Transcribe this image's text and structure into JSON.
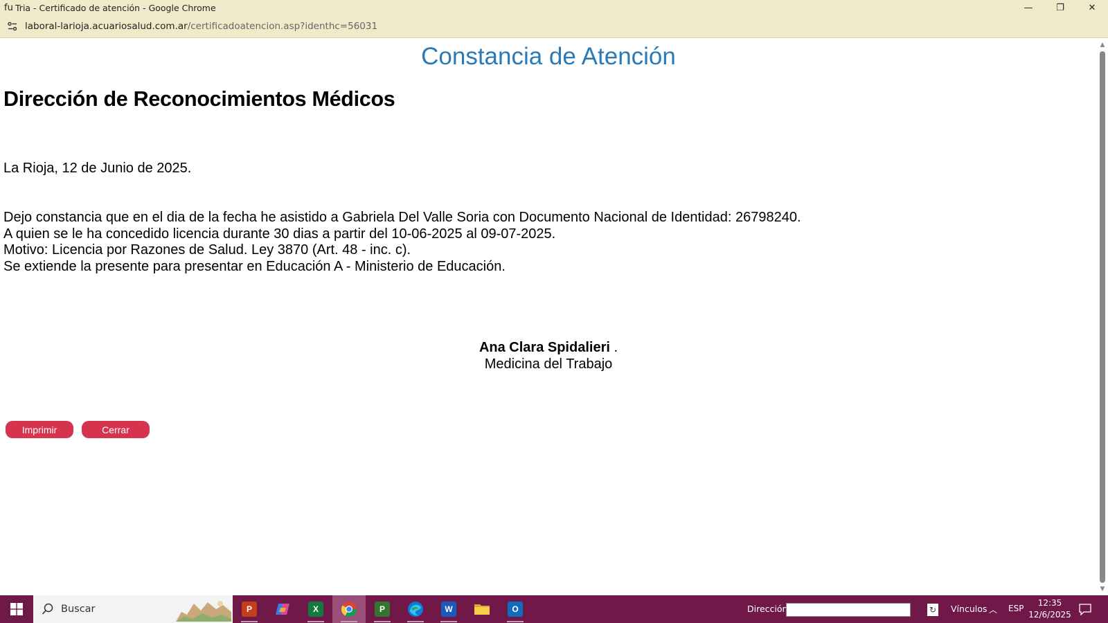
{
  "window": {
    "tab_icon": "fu",
    "title": "Tria - Certificado de atención - Google Chrome",
    "controls": {
      "minimize": "—",
      "restore": "❐",
      "close": "✕"
    }
  },
  "address": {
    "host": "laboral-larioja.acuariosalud.com.ar",
    "path": "/certificadoatencion.asp?identhc=56031"
  },
  "page": {
    "heading": "Constancia de Atención",
    "organization": "Dirección de Reconocimientos Médicos",
    "date_line": "La Rioja, 12 de Junio de 2025.",
    "body_lines": [
      "Dejo constancia que en el dia de la fecha he asistido a Gabriela Del Valle Soria con Documento Nacional de Identidad: 26798240.",
      "A quien se le ha concedido licencia durante 30 dias a partir del 10-06-2025 al 09-07-2025.",
      "Motivo: Licencia por Razones de Salud. Ley 3870 (Art. 48 - inc. c).",
      "Se extiende la presente para presentar en Educación A - Ministerio de Educación."
    ],
    "signer_name": "Ana Clara Spidalieri",
    "signer_suffix": " .",
    "signer_role": "Medicina del Trabajo",
    "buttons": {
      "print": "Imprimir",
      "close": "Cerrar"
    },
    "button_color": "#d6334f",
    "heading_color": "#2a7ab8"
  },
  "taskbar": {
    "search_placeholder": "Buscar",
    "apps": [
      {
        "name": "powerpoint",
        "letter": "P",
        "color": "#c43e1c"
      },
      {
        "name": "copilot",
        "letter": "",
        "color": "#6b5bd6"
      },
      {
        "name": "excel",
        "letter": "X",
        "color": "#107c41"
      },
      {
        "name": "chrome",
        "letter": "",
        "color": "#4285f4"
      },
      {
        "name": "project",
        "letter": "P",
        "color": "#31752f"
      },
      {
        "name": "edge",
        "letter": "",
        "color": "#0c7bd1"
      },
      {
        "name": "word",
        "letter": "W",
        "color": "#185abd"
      },
      {
        "name": "file-explorer",
        "letter": "",
        "color": "#f0c330"
      },
      {
        "name": "outlook",
        "letter": "O",
        "color": "#0f6cbd"
      }
    ],
    "address_label": "Dirección",
    "address_value": "",
    "links_label": "Vínculos",
    "language": "ESP",
    "time": "12:35",
    "date": "12/6/2025",
    "background": "#701848"
  }
}
